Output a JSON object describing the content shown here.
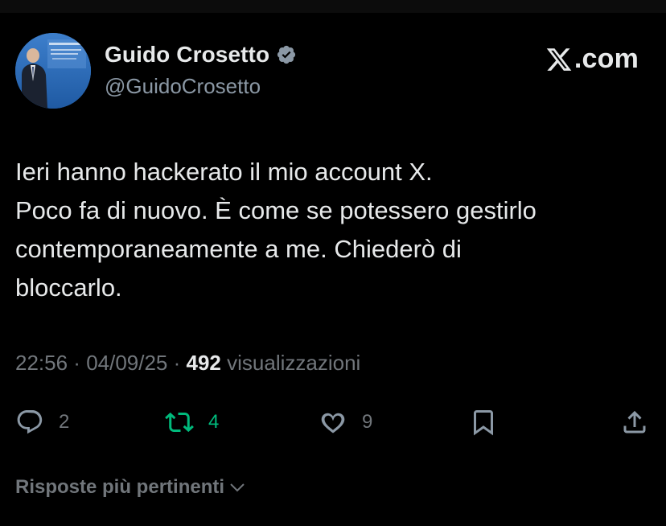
{
  "profile": {
    "display_name": "Guido Crosetto",
    "handle": "@GuidoCrosetto",
    "avatar_icon": "profile-photo",
    "verified_icon": "verified-badge-icon",
    "verified_color": "#8b98a5"
  },
  "brand": {
    "logo_icon": "x-logo-icon",
    "text": ".com"
  },
  "tweet": {
    "lines": [
      "Ieri hanno hackerato il mio account X.",
      "Poco fa di nuovo. È come se potessero gestirlo",
      "contemporaneamente a me. Chiederò di",
      "bloccarlo."
    ]
  },
  "meta": {
    "time": "22:56",
    "separator": " · ",
    "date": "04/09/25",
    "views_count": "492",
    "views_label": "visualizzazioni"
  },
  "actions": {
    "replies": {
      "icon": "reply-icon",
      "count": "2"
    },
    "retweets": {
      "icon": "retweet-icon",
      "count": "4",
      "color": "#00ba7c"
    },
    "likes": {
      "icon": "heart-icon",
      "count": "9"
    },
    "bookmark": {
      "icon": "bookmark-icon"
    },
    "share": {
      "icon": "share-icon"
    }
  },
  "replies_sort": {
    "label": "Risposte più pertinenti",
    "icon": "chevron-down-icon"
  },
  "colors": {
    "background": "#000000",
    "text_primary": "#e7e9ea",
    "text_secondary": "#71767b",
    "retweet_green": "#00ba7c"
  }
}
